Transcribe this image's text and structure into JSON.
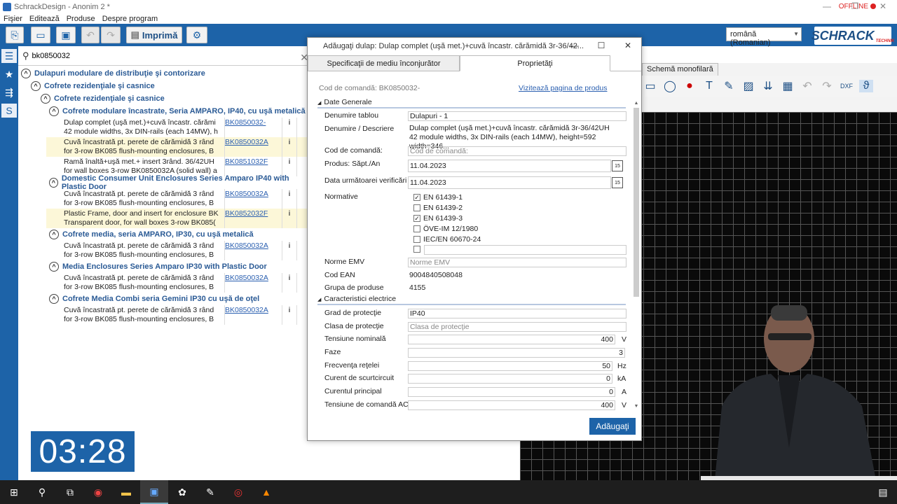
{
  "window": {
    "title": "SchrackDesign - Anonim 2 *",
    "status": "OFFLINE",
    "controls": [
      "—",
      "❐",
      "✕"
    ]
  },
  "menu": [
    "Fişier",
    "Editează",
    "Produse",
    "Despre program"
  ],
  "toolbar": {
    "print_label": "Imprimă",
    "language": "română (Romanian)",
    "brand": "SCHRACK",
    "brand_sub": "TECHNIK"
  },
  "search": {
    "value": "bk0850032",
    "placeholder": ""
  },
  "tree": {
    "root": "Dulapuri modulare de distribuţie şi contorizare",
    "l1": "Cofrete rezidenţiale şi casnice",
    "l2": "Cofrete rezidenţiale şi casnice",
    "groups": [
      {
        "title": "Cofrete modulare încastrate, Seria AMPARO, IP40, cu uşă metalică",
        "rows": [
          {
            "line1": "Dulap complet (uşă met.)+cuvă încastr. cărămi",
            "line2": "42 module widths, 3x DIN-rails (each 14MW), h",
            "code": "BK0850032-",
            "hl": false
          },
          {
            "line1": "Cuvă încastrată pt. perete de cărămidă 3 rând",
            "line2": "for 3-row BK085 flush-mounting enclosures, B",
            "code": "BK0850032A",
            "hl": true
          },
          {
            "line1": "Ramă înaltă+uşă met.+ insert 3rând. 36/42UH",
            "line2": "for wall boxes 3-row BK0850032A (solid wall) a",
            "code": "BK0851032F",
            "hl": false
          }
        ]
      },
      {
        "title": "Domestic Consumer Unit Enclosures Series Amparo IP40 with Plastic Door",
        "rows": [
          {
            "line1": "Cuvă încastrată pt. perete de cărămidă 3 rând",
            "line2": "for 3-row BK085 flush-mounting enclosures, B",
            "code": "BK0850032A",
            "hl": false
          },
          {
            "line1": "Plastic Frame, door and insert for enclosure BK",
            "line2": "Transparent door, for wall boxes 3-row BK085(",
            "code": "BK0852032F",
            "hl": true
          }
        ]
      },
      {
        "title": "Cofrete media, seria AMPARO, IP30, cu uşă metalică",
        "rows": [
          {
            "line1": "Cuvă încastrată pt. perete de cărămidă 3 rând",
            "line2": "for 3-row BK085 flush-mounting enclosures, B",
            "code": "BK0850032A",
            "hl": false
          }
        ]
      },
      {
        "title": "Media Enclosures Series Amparo IP30 with Plastic Door",
        "rows": [
          {
            "line1": "Cuvă încastrată pt. perete de cărămidă 3 rând",
            "line2": "for 3-row BK085 flush-mounting enclosures, B",
            "code": "BK0850032A",
            "hl": false
          }
        ]
      },
      {
        "title": "Cofrete Media Combi seria Gemini IP30 cu uşă de oţel",
        "rows": [
          {
            "line1": "Cuvă încastrată pt. perete de cărămidă 3 rând",
            "line2": "for 3-row BK085 flush-mounting enclosures, B",
            "code": "BK0850032A",
            "hl": false
          }
        ]
      }
    ]
  },
  "timer": "03:28",
  "schematic": {
    "tab": "Schemă monofilară"
  },
  "dialog": {
    "title": "Adăugaţi dulap: Dulap complet (uşă met.)+cuvă încastr. cărămidă 3r-36/42...",
    "tabs": [
      "Specificaţii de mediu înconjurător",
      "Proprietăţi"
    ],
    "order_code_caption": "Cod de comandă: BK0850032-",
    "product_link": "Vizitează pagina de produs",
    "section_general": "Date Generale",
    "section_electrical": "Caracteristici electrice",
    "fields": {
      "denumire_tablou": {
        "label": "Denumire tablou",
        "value": "Dulapuri - 1"
      },
      "denumire_descriere": {
        "label": "Denumire / Descriere",
        "value1": "Dulap complet (uşă met.)+cuvă încastr. cărămidă 3r-36/42UH",
        "value2": "42 module widths, 3x DIN-rails (each 14MW), height=592 width=346..."
      },
      "cod_comanda": {
        "label": "Cod de comandă:",
        "placeholder": "Cod de comandă:"
      },
      "produs": {
        "label": "Produs: Săpt./An",
        "value": "11.04.2023"
      },
      "verificare": {
        "label": "Data următoarei verificări",
        "value": "11.04.2023"
      },
      "normative": {
        "label": "Normative"
      },
      "norme_emv": {
        "label": "Norme EMV",
        "placeholder": "Norme EMV"
      },
      "ean": {
        "label": "Cod EAN",
        "value": "9004840508048"
      },
      "grupa": {
        "label": "Grupa de produse",
        "value": "4155"
      },
      "grad_protectie": {
        "label": "Grad de protecţie",
        "value": "IP40"
      },
      "clasa_protectie": {
        "label": "Clasa de protecţie",
        "placeholder": "Clasa de protecţie"
      },
      "tensiune_nominala": {
        "label": "Tensiune nominală",
        "value": "400",
        "unit": "V"
      },
      "faze": {
        "label": "Faze",
        "value": "3",
        "unit": ""
      },
      "frecventa": {
        "label": "Frecvenţa reţelei",
        "value": "50",
        "unit": "Hz"
      },
      "scurtcircuit": {
        "label": "Curent de scurtcircuit",
        "value": "0",
        "unit": "kA"
      },
      "curent_principal": {
        "label": "Curentul principal",
        "value": "0",
        "unit": "A"
      },
      "tensiune_comanda": {
        "label": "Tensiune de comandă AC",
        "value": "400",
        "unit": "V"
      }
    },
    "norms": [
      {
        "label": "EN 61439-1",
        "checked": true
      },
      {
        "label": "EN 61439-2",
        "checked": false
      },
      {
        "label": "EN 61439-3",
        "checked": true
      },
      {
        "label": "ÖVE-IM 12/1980",
        "checked": false
      },
      {
        "label": "IEC/EN 60670-24",
        "checked": false
      }
    ],
    "calendar_icon": "15",
    "add_button": "Adăugaţi"
  },
  "colors": {
    "accent": "#1d63a8",
    "highlight_row": "#fcf7d8",
    "link": "#2a5fb0",
    "offline": "#dd2222"
  }
}
